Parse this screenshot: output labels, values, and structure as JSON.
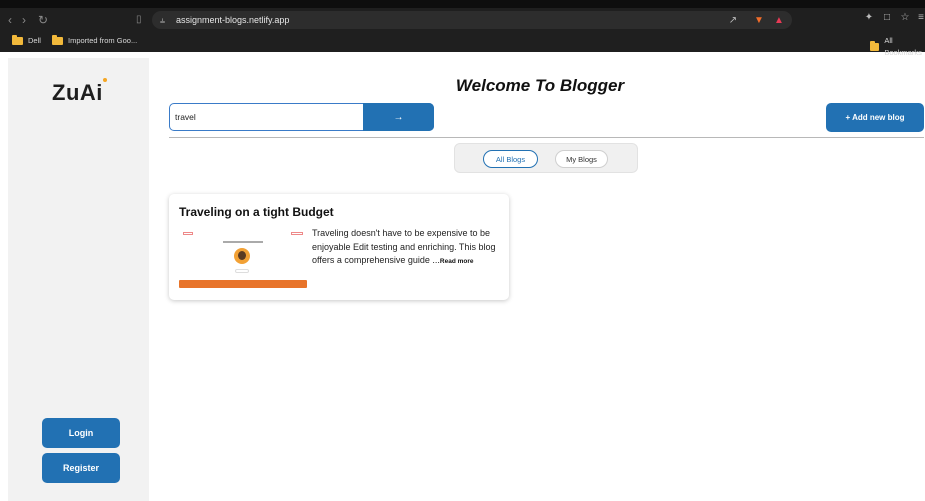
{
  "browser": {
    "url": "assignment-blogs.netlify.app",
    "bookmarks": [
      {
        "label": "Dell"
      },
      {
        "label": "Imported from Goo..."
      }
    ],
    "all_bookmarks_label": "All Bookmarks"
  },
  "sidebar": {
    "logo": "ZuAi",
    "login_label": "Login",
    "register_label": "Register"
  },
  "header": {
    "title": "Welcome To Blogger"
  },
  "search": {
    "value": "travel",
    "submit_icon": "→"
  },
  "actions": {
    "add_blog_label": "+ Add new blog"
  },
  "tabs": [
    {
      "label": "All Blogs",
      "active": true
    },
    {
      "label": "My Blogs",
      "active": false
    }
  ],
  "blogs": [
    {
      "title": "Traveling on a tight Budget",
      "excerpt": "Traveling doesn't have to be expensive to be enjoyable Edit testing and enriching. This blog offers a comprehensive guide ...",
      "read_more": "Read more"
    }
  ],
  "colors": {
    "primary": "#2271b3",
    "sidebar_bg": "#f2f2f2",
    "thumb_accent": "#e8742a"
  }
}
